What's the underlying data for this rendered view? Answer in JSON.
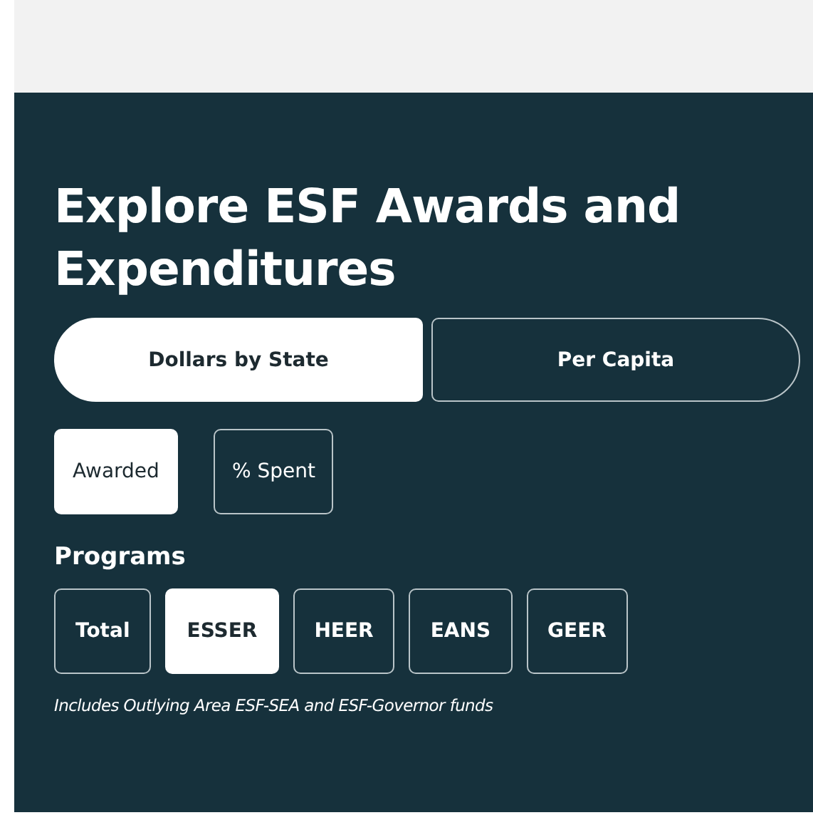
{
  "title": "Explore ESF Awards and Expenditures",
  "views": [
    {
      "label": "Dollars by State",
      "selected": true
    },
    {
      "label": "Per Capita",
      "selected": false
    }
  ],
  "measures": [
    {
      "label": "Awarded",
      "selected": true
    },
    {
      "label": "% Spent",
      "selected": false
    }
  ],
  "programs_heading": "Programs",
  "programs": [
    {
      "label": "Total",
      "selected": false
    },
    {
      "label": "ESSER",
      "selected": true
    },
    {
      "label": "HEER",
      "selected": false
    },
    {
      "label": "EANS",
      "selected": false
    },
    {
      "label": "GEER",
      "selected": false
    }
  ],
  "note": "Includes Outlying Area ESF-SEA and ESF-Governor funds"
}
